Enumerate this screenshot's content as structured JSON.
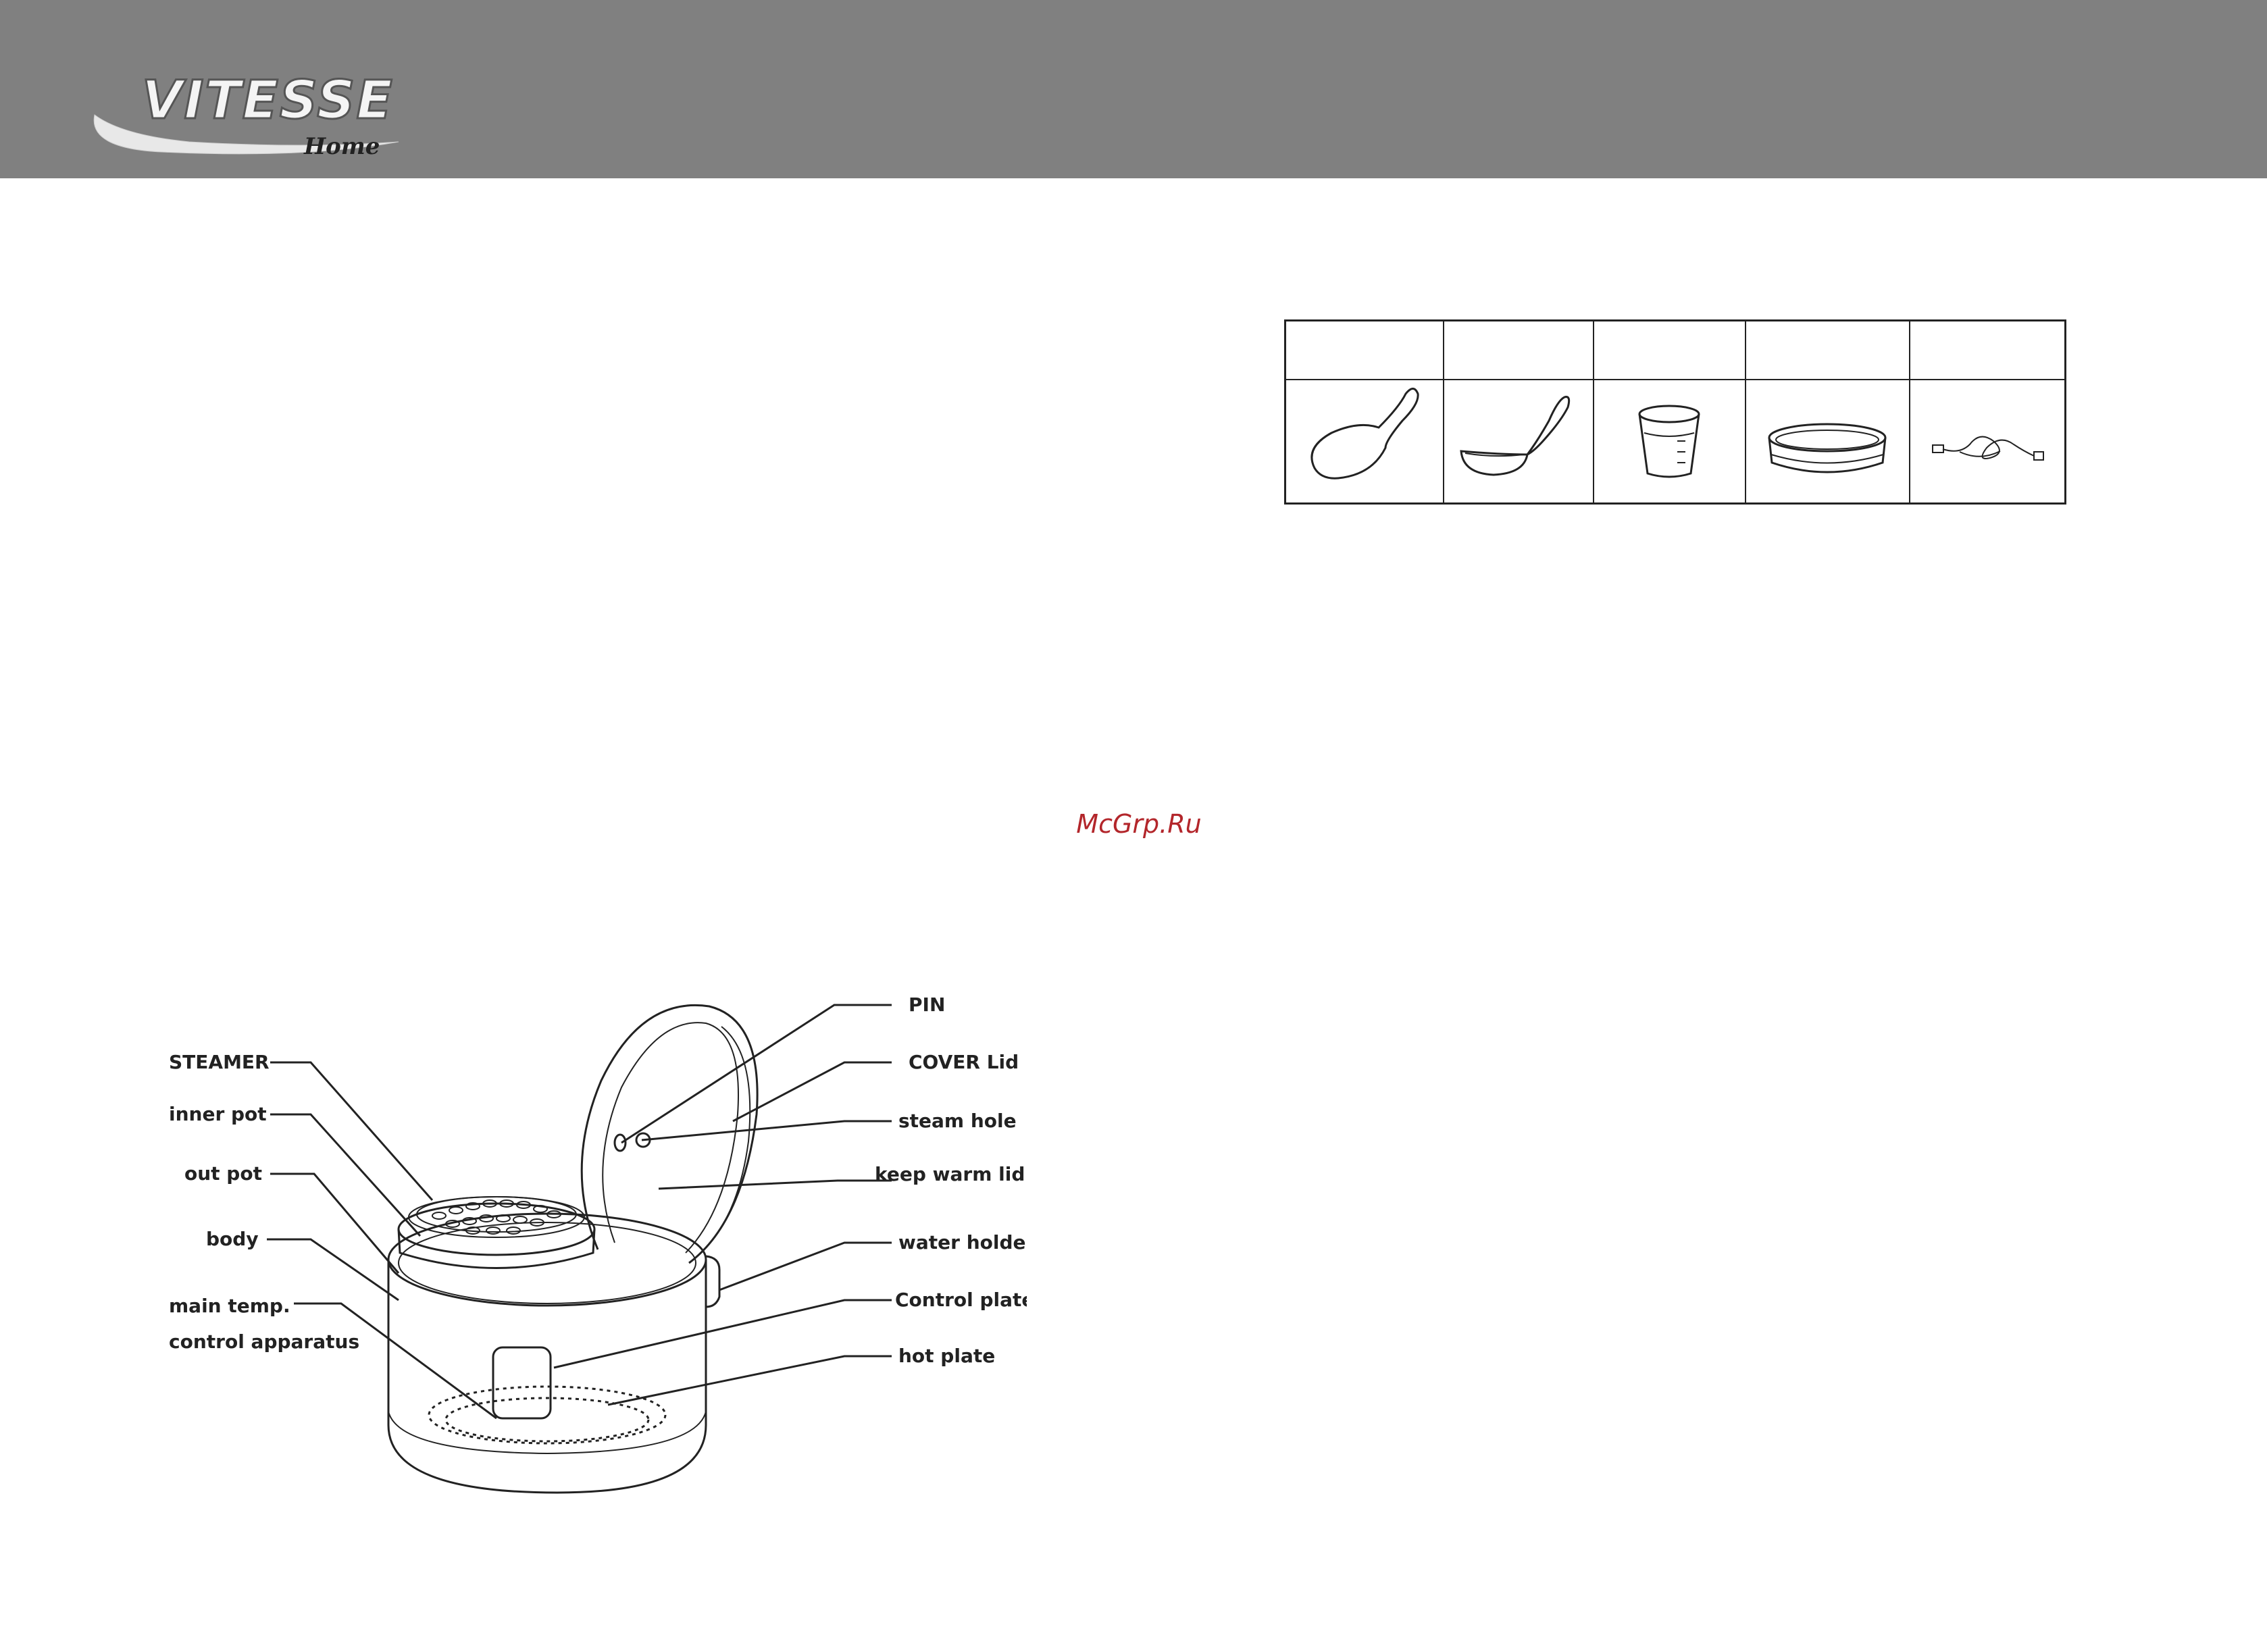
{
  "header": {
    "brand": "VITESSE",
    "brand_sub": "Home"
  },
  "watermark": "McGrp.Ru",
  "accessories": {
    "icons": [
      "rice-spoon-icon",
      "soup-ladle-icon",
      "measuring-cup-icon",
      "steamer-tray-icon",
      "power-cord-icon"
    ]
  },
  "diagram": {
    "labels": {
      "steamer": "STEAMER",
      "inner_pot": "inner pot",
      "out_pot": "out pot",
      "body": "body",
      "main_temp_1": "main temp.",
      "main_temp_2": "control apparatus",
      "pin": "PIN",
      "cover_lid": "COVER Lid",
      "steam_hole": "steam hole",
      "keep_warm_lid": "keep warm lid",
      "water_holder": "water holde",
      "control_plate": "Control plate",
      "hot_plate": "hot plate"
    }
  },
  "colors": {
    "header_bg": "#808080",
    "watermark": "#b3262b"
  }
}
